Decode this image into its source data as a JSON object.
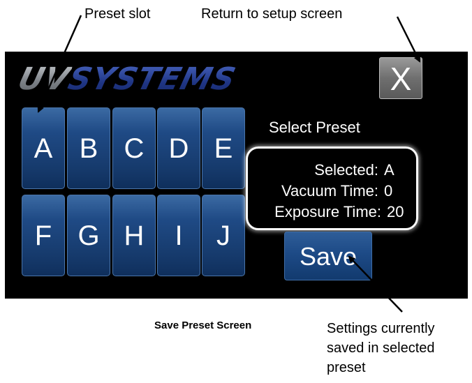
{
  "annotations": {
    "preset_slot": "Preset slot",
    "return_setup": "Return to setup screen",
    "settings_line1": "Settings currently",
    "settings_line2": "saved in selected",
    "settings_line3": "preset"
  },
  "caption": "Save Preset Screen",
  "screen": {
    "logo_part1": "UV",
    "logo_part2": "SYSTEMS",
    "close_label": "X",
    "keys_row1": [
      "A",
      "B",
      "C",
      "D",
      "E"
    ],
    "keys_row2": [
      "F",
      "G",
      "H",
      "I",
      "J"
    ],
    "select_title": "Select Preset",
    "info": {
      "selected_label": "Selected:",
      "selected_value": "A",
      "vacuum_label": "Vacuum Time:",
      "vacuum_value": "0",
      "exposure_label": "Exposure Time:",
      "exposure_value": "20"
    },
    "save_label": "Save"
  },
  "colors": {
    "screen_bg": "#000000",
    "button_blue": "#1f4a85",
    "close_gray": "#6f6f6f",
    "logo_gray": "#8a8f94",
    "logo_blue": "#243c8c"
  }
}
